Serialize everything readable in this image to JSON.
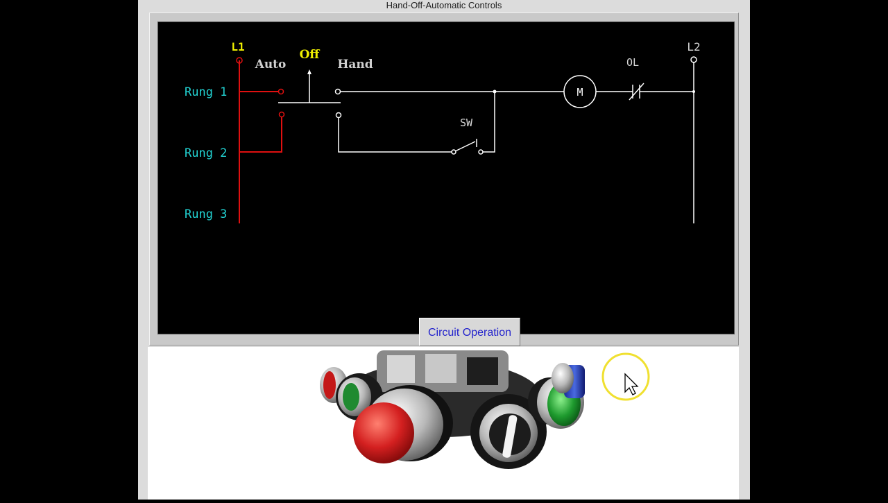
{
  "window": {
    "title": "Hand-Off-Automatic Controls"
  },
  "diagram": {
    "l1": "L1",
    "l2": "L2",
    "switch_positions": {
      "auto": "Auto",
      "off": "Off",
      "hand": "Hand"
    },
    "rungs": [
      "Rung 1",
      "Rung 2",
      "Rung 3"
    ],
    "motor": "M",
    "overload": "OL",
    "sw": "SW"
  },
  "button": {
    "label": "Circuit Operation"
  },
  "image": {
    "subject": "industrial pushbuttons and selector switch"
  },
  "colors": {
    "live_wire": "#e01010",
    "rung_label": "#22d3d3",
    "highlight": "#f0f000",
    "wire": "#ffffff"
  }
}
